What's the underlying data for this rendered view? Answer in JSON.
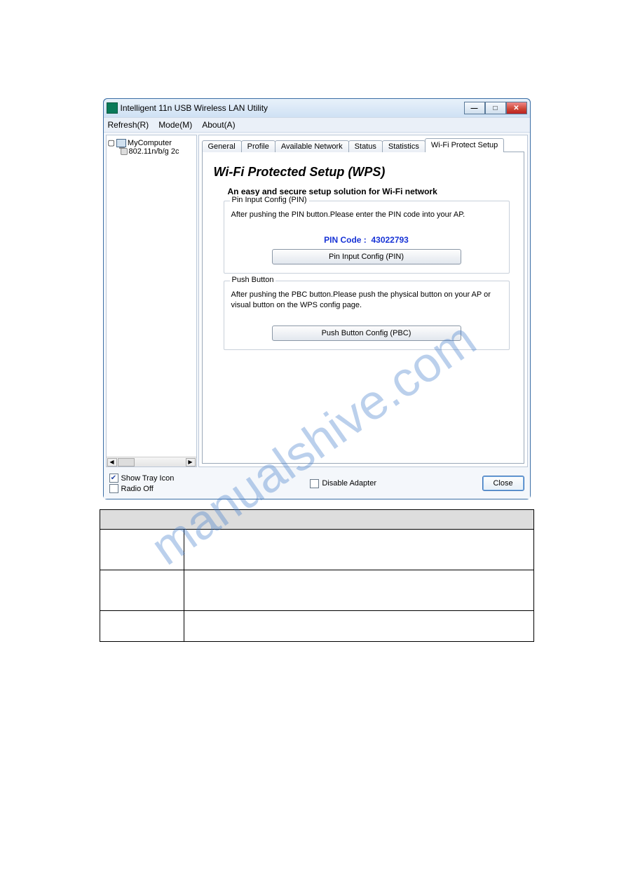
{
  "window": {
    "title": "Intelligent 11n USB Wireless LAN Utility"
  },
  "menu": {
    "refresh": "Refresh(R)",
    "mode": "Mode(M)",
    "about": "About(A)"
  },
  "tree": {
    "root": "MyComputer",
    "adapter": "802.11n/b/g 2c"
  },
  "tabs": {
    "general": "General",
    "profile": "Profile",
    "available": "Available Network",
    "status": "Status",
    "statistics": "Statistics",
    "wps": "Wi-Fi Protect Setup"
  },
  "wps": {
    "heading": "Wi-Fi Protected Setup (WPS)",
    "subheading": "An easy and secure setup solution for Wi-Fi network",
    "pin_group_title": "Pin Input Config (PIN)",
    "pin_instruction": "After pushing the PIN button.Please enter the PIN code into your AP.",
    "pin_label": "PIN Code :",
    "pin_code": "43022793",
    "pin_button": "Pin Input Config (PIN)",
    "pbc_group_title": "Push Button",
    "pbc_instruction": "After pushing the PBC button.Please push the physical button on your AP or visual button on the WPS config page.",
    "pbc_button": "Push Button Config (PBC)"
  },
  "footer": {
    "show_tray": "Show Tray Icon",
    "radio_off": "Radio Off",
    "disable_adapter": "Disable Adapter",
    "close": "Close"
  },
  "watermark": "manualshive.com"
}
